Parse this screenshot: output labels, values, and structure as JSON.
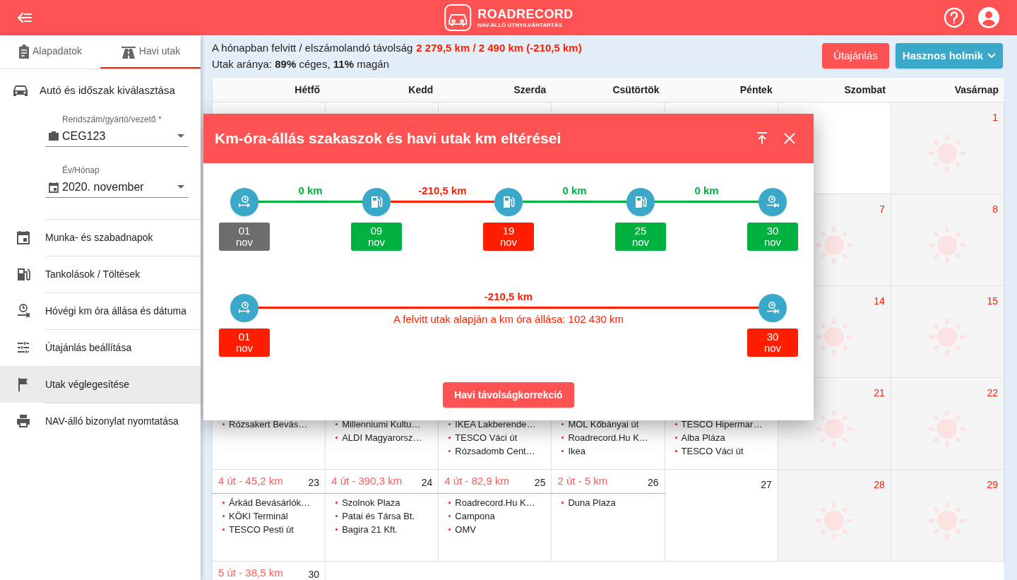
{
  "header": {
    "logo_title": "ROADRECORD",
    "logo_subtitle": "NAV-ÁLLÓ ÚTNYILVÁNTARTÁS"
  },
  "sidebar": {
    "tabs": [
      {
        "label": "Alapadatok",
        "selected": false
      },
      {
        "label": "Havi utak",
        "selected": true
      }
    ],
    "section_title": "Autó és időszak kiválasztása",
    "fields": [
      {
        "label": "Rendszám/gyártó/vezető *",
        "value": "CEG123"
      },
      {
        "label": "Év/Hónap",
        "value": "2020. november"
      }
    ],
    "items": [
      {
        "label": "Munka- és szabadnapok",
        "selected": false
      },
      {
        "label": "Tankolások / Töltések",
        "selected": false
      },
      {
        "label": "Hóvégi km óra állása és dátuma",
        "selected": false
      },
      {
        "label": "Útajánlás beállítása",
        "selected": false
      },
      {
        "label": "Utak véglegesítése",
        "selected": true
      },
      {
        "label": "NAV-álló bizonylat nyomtatása",
        "selected": false
      }
    ]
  },
  "summary": {
    "label": "A hónapban felvitt / elszámolandó távolság",
    "value": "2 279,5 km / 2 490 km (-210,5 km)",
    "ratio": "Utak aránya: **89%** céges, **11%** magán"
  },
  "buttons": [
    {
      "label": "Útajánlás",
      "kind": "primary"
    },
    {
      "label": "Hasznos holmik",
      "kind": "menu"
    }
  ],
  "calendar": {
    "weekdays": [
      "Hétfő",
      "Kedd",
      "Szerda",
      "Csütörtök",
      "Péntek",
      "Szombat",
      "Vasárnap"
    ],
    "weeks": [
      [
        {
          "kind": "empty"
        },
        {
          "kind": "empty"
        },
        {
          "kind": "empty"
        },
        {
          "kind": "empty"
        },
        {
          "kind": "empty"
        },
        {
          "kind": "empty"
        },
        {
          "kind": "weekend",
          "day": "1"
        }
      ],
      [
        {
          "kind": "blank"
        },
        {
          "kind": "blank"
        },
        {
          "kind": "blank"
        },
        {
          "kind": "blank"
        },
        {
          "kind": "blank"
        },
        {
          "kind": "weekend",
          "day": "7"
        },
        {
          "kind": "weekend",
          "day": "8"
        }
      ],
      [
        {
          "kind": "blank"
        },
        {
          "kind": "blank"
        },
        {
          "kind": "blank"
        },
        {
          "kind": "blank"
        },
        {
          "kind": "blank"
        },
        {
          "kind": "weekend",
          "day": "14"
        },
        {
          "kind": "weekend",
          "day": "15"
        }
      ],
      [
        {
          "kind": "trips",
          "places": [
            "Rózsakert Bevás…"
          ]
        },
        {
          "kind": "trips",
          "places": [
            "Millenniumi Kultu…",
            "ALDI Magyarorsz…"
          ]
        },
        {
          "kind": "trips",
          "places": [
            "IKEA Lakberende…",
            "TESCO Váci út",
            "Rózsadomb Cent…"
          ]
        },
        {
          "kind": "trips",
          "places": [
            "MOL Kőbányai út",
            "Roadrecord.Hu K…",
            "Ikea"
          ]
        },
        {
          "kind": "trips",
          "places": [
            "TESCO Hipermar…",
            "Alba Pláza",
            "TESCO Váci út"
          ]
        },
        {
          "kind": "weekend",
          "day": "21"
        },
        {
          "kind": "weekend",
          "day": "22"
        }
      ],
      [
        {
          "kind": "trips",
          "day": "23",
          "summary": "4 út - 45,2 km",
          "places": [
            "Árkád Bevásárlók…",
            "KÖKI Terminál",
            "TESCO Pesti út"
          ]
        },
        {
          "kind": "trips",
          "day": "24",
          "summary": "4 út - 390,3 km",
          "places": [
            "Szolnok Plaza",
            "Patai és Társa Bt.",
            "Bagira 21 Kft."
          ]
        },
        {
          "kind": "trips",
          "day": "25",
          "summary": "4 út - 82,9 km",
          "places": [
            "Roadrecord.Hu K…",
            "Campona",
            "OMV"
          ]
        },
        {
          "kind": "trips",
          "day": "26",
          "summary": "2 út - 5 km",
          "places": [
            "Duna Plaza"
          ]
        },
        {
          "kind": "day",
          "day": "27"
        },
        {
          "kind": "weekend",
          "day": "28"
        },
        {
          "kind": "weekend",
          "day": "29"
        }
      ],
      [
        {
          "kind": "trips",
          "day": "30",
          "summary": "5 út - 38,5 km"
        }
      ]
    ]
  },
  "dialog": {
    "title": "Km-óra-állás szakaszok és havi utak km eltérései",
    "timelines": [
      {
        "nodes": [
          {
            "kind": "start",
            "day": "01",
            "month": "nov",
            "color": "#6d6d6d"
          },
          {
            "kind": "fuel",
            "day": "09",
            "month": "nov",
            "color": "#00b140"
          },
          {
            "kind": "fuel",
            "day": "19",
            "month": "nov",
            "color": "#ff1e00"
          },
          {
            "kind": "fuel",
            "day": "25",
            "month": "nov",
            "color": "#00b140"
          },
          {
            "kind": "end",
            "day": "30",
            "month": "nov",
            "color": "#00b140"
          }
        ],
        "segments": [
          {
            "label": "0 km",
            "color": "#00b140"
          },
          {
            "label": "-210,5 km",
            "color": "#ff1e00"
          },
          {
            "label": "0 km",
            "color": "#00b140"
          },
          {
            "label": "0 km",
            "color": "#00b140"
          }
        ]
      },
      {
        "nodes": [
          {
            "kind": "start",
            "day": "01",
            "month": "nov",
            "color": "#ff1e00"
          },
          {
            "kind": "end",
            "day": "30",
            "month": "nov",
            "color": "#ff1e00"
          }
        ],
        "segments": [
          {
            "label": "-210,5 km",
            "note": "A felvitt utak alapján a km óra állása: 102 430 km",
            "color": "#ff1e00"
          }
        ]
      }
    ],
    "button": "Havi távolságkorrekció"
  }
}
